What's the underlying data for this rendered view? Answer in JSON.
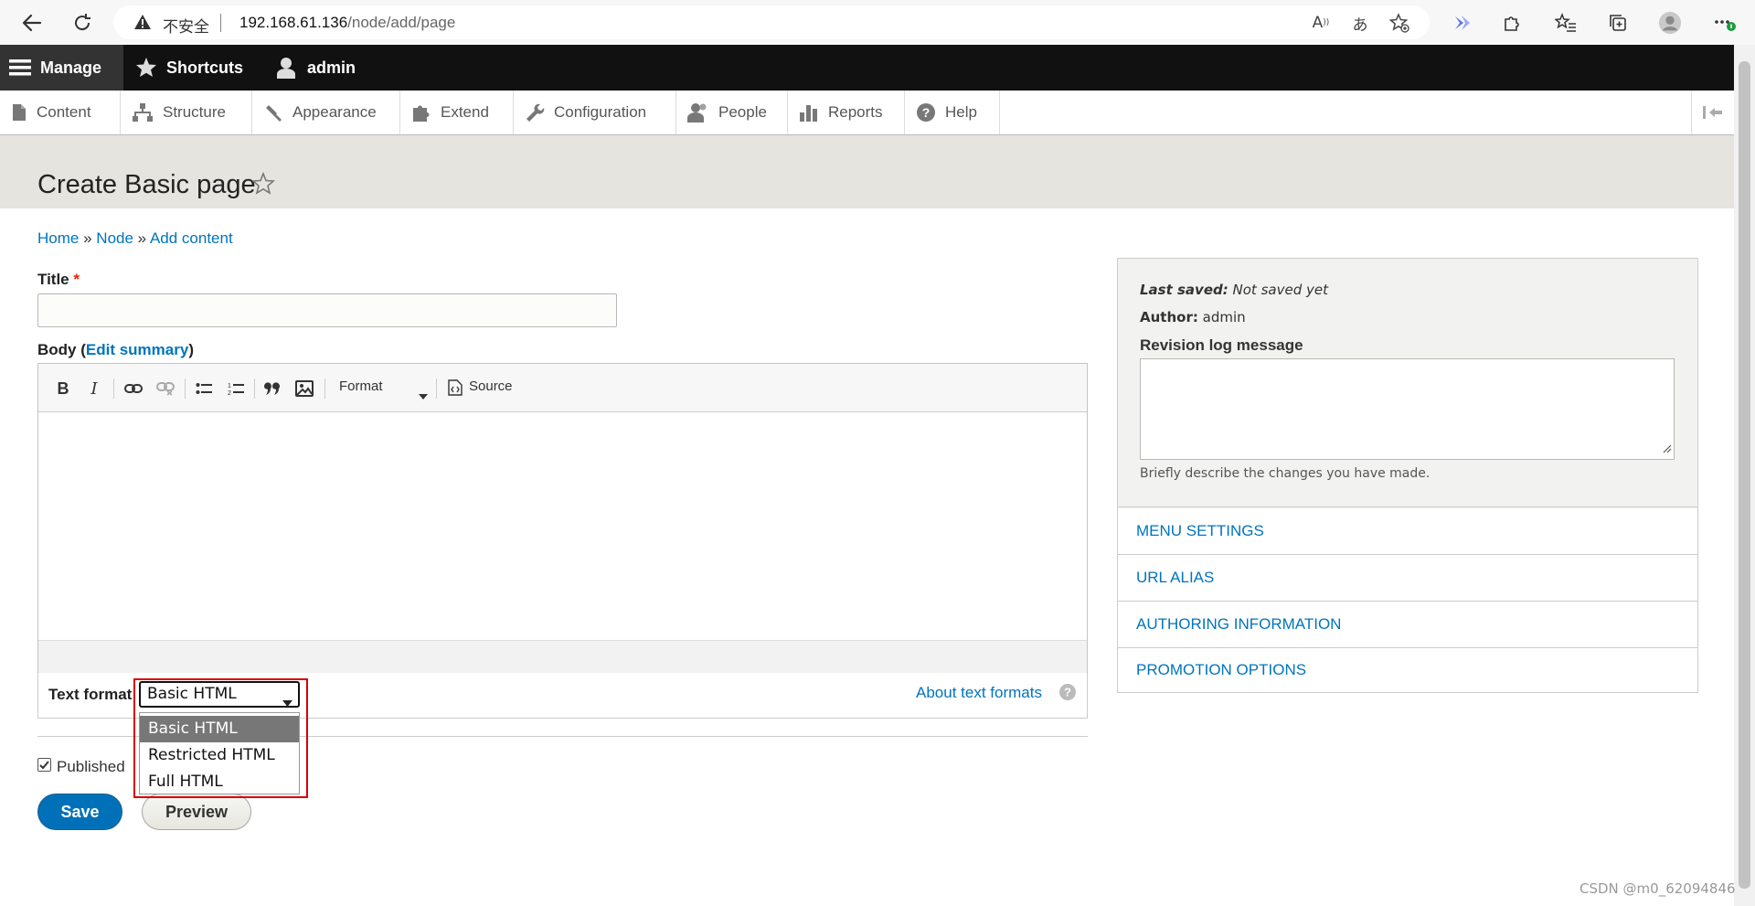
{
  "browser": {
    "insecure_label": "不安全",
    "url_host": "192.168.61.136",
    "url_path": "/node/add/page"
  },
  "toolbar": {
    "manage": "Manage",
    "shortcuts": "Shortcuts",
    "user": "admin"
  },
  "tray": {
    "items": [
      {
        "label": "Content",
        "icon": "file-icon"
      },
      {
        "label": "Structure",
        "icon": "sitemap-icon"
      },
      {
        "label": "Appearance",
        "icon": "paintbrush-icon"
      },
      {
        "label": "Extend",
        "icon": "puzzle-icon"
      },
      {
        "label": "Configuration",
        "icon": "wrench-icon"
      },
      {
        "label": "People",
        "icon": "people-icon"
      },
      {
        "label": "Reports",
        "icon": "bar-chart-icon"
      },
      {
        "label": "Help",
        "icon": "help-icon"
      }
    ]
  },
  "page": {
    "title": "Create Basic page"
  },
  "breadcrumb": {
    "home": "Home",
    "node": "Node",
    "add_content": "Add content",
    "separator": "»"
  },
  "form": {
    "title_label": "Title",
    "required_mark": "*",
    "title_value": "",
    "body_label": "Body",
    "edit_summary": "Edit summary",
    "format_dropdown": "Format",
    "source_button": "Source",
    "text_format_label": "Text format",
    "text_format_selected": "Basic HTML",
    "text_format_options": [
      "Basic HTML",
      "Restricted HTML",
      "Full HTML"
    ],
    "about_text_formats": "About text formats",
    "published_label": "Published",
    "published_checked": true,
    "save_label": "Save",
    "preview_label": "Preview"
  },
  "sidebar": {
    "last_saved_label": "Last saved:",
    "last_saved_value": "Not saved yet",
    "author_label": "Author:",
    "author_value": "admin",
    "revision_label": "Revision log message",
    "revision_value": "",
    "revision_description": "Briefly describe the changes you have made.",
    "sections": [
      "MENU SETTINGS",
      "URL ALIAS",
      "AUTHORING INFORMATION",
      "PROMOTION OPTIONS"
    ]
  },
  "watermark": "CSDN @m0_62094846",
  "colors": {
    "link": "#0074bd",
    "toolbar_bg": "#111111",
    "primary_button": "#0071b8",
    "highlight_border": "#d40000",
    "header_bg": "#e5e4df"
  }
}
